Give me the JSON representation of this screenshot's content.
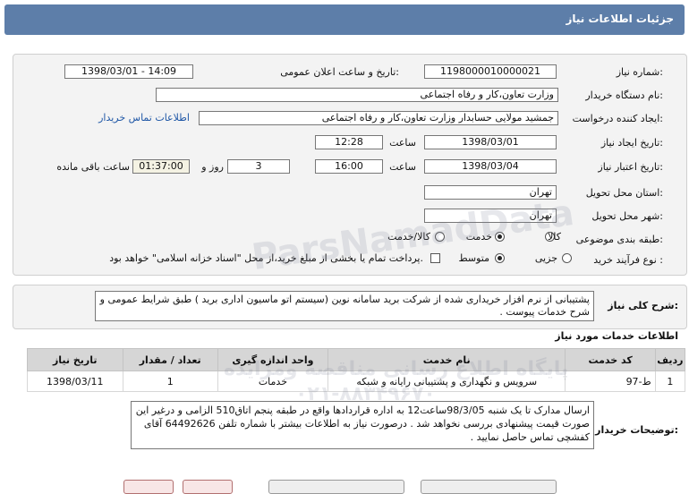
{
  "header": {
    "title": "جزئیات اطلاعات نیاز"
  },
  "form": {
    "need_number_label": "شماره نیاز:",
    "need_number": "1198000010000021",
    "announce_label": "تاریخ و ساعت اعلان عمومی:",
    "announce_value": "1398/03/01 - 14:09",
    "buyer_org_label": "نام دستگاه خریدار:",
    "buyer_org": "وزارت تعاون،کار و رفاه اجتماعی",
    "requester_label": "ایجاد کننده درخواست:",
    "requester": "جمشید مولایی حسابدار وزارت تعاون،کار و رفاه اجتماعی",
    "buyer_contact_link": "اطلاعات تماس خریدار",
    "created_label": "تاریخ ایجاد نیاز:",
    "created_date": "1398/03/01",
    "time_label": "ساعت",
    "created_time": "12:28",
    "deadline_label": "تاریخ اعتبار نیاز:",
    "deadline_date": "1398/03/04",
    "deadline_time": "16:00",
    "days_value": "3",
    "days_label": "روز و",
    "remaining_time": "01:37:00",
    "remaining_label": "ساعت باقی مانده",
    "province_label": "استان محل تحویل:",
    "province": "تهران",
    "city_label": "شهر محل تحویل:",
    "city": "تهران",
    "category_label": "طبقه بندی موضوعی:",
    "category_options": [
      "کالا",
      "خدمت",
      "کالا/خدمت"
    ],
    "category_selected": "خدمت",
    "process_label": "نوع فرآیند خرید :",
    "process_options": [
      "جزیی",
      "متوسط"
    ],
    "process_selected": "متوسط",
    "treasury_note": "پرداخت تمام یا بخشی از مبلغ خرید،از محل \"اسناد خزانه اسلامی\" خواهد بود."
  },
  "description": {
    "label": "شرح کلی نیاز:",
    "text": "پشتیبانی از نرم افزار خریداری شده از شرکت برید سامانه نوین (سیستم اتو ماسیون اداری برید ) طبق شرایط عمومی و شرح خدمات پیوست ."
  },
  "services": {
    "heading": "اطلاعات خدمات مورد نیاز",
    "columns": [
      "ردیف",
      "کد خدمت",
      "نام خدمت",
      "واحد اندازه گیری",
      "تعداد / مقدار",
      "تاریخ نیاز"
    ],
    "rows": [
      [
        "1",
        "ط-97",
        "سرویس و نگهداری و پشتیبانی رایانه و شبکه",
        "خدمات",
        "1",
        "1398/03/11"
      ]
    ]
  },
  "buyer_notes": {
    "label": "توضیحات خریدار:",
    "text": "ارسال مدارک تا یک شنبه 98/3/05ساعت12 به اداره قراردادها واقع در طبقه پنجم اتاق510 الزامی و درغیر این صورت قیمت پیشنهادی بررسی نخواهد شد . درصورت نیاز به اطلاعات بیشتر با شماره تلفن 64492626 آقای کفشچی تماس حاصل نمایید ."
  },
  "watermark": {
    "line1": "ParsNamadData",
    "line2": "پایگاه اطلاع رسانی مناقصه ومزایده",
    "phone": "۰۲۱-۸۸۳۴۹۶۷۰"
  }
}
